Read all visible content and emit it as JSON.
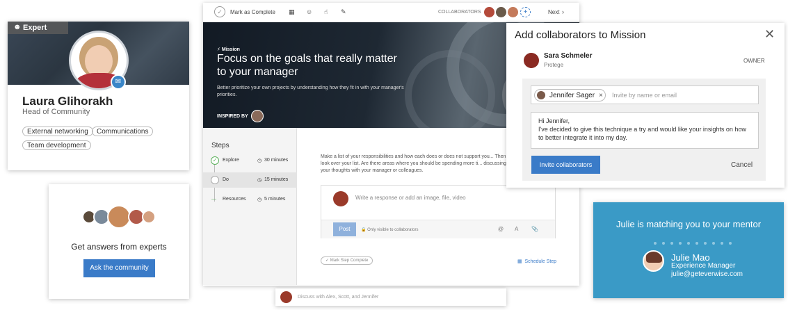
{
  "profile": {
    "badge": "Expert",
    "name": "Laura Glihorakh",
    "role": "Head of Community",
    "tags": [
      "External networking",
      "Communications",
      "Team development"
    ]
  },
  "ask": {
    "title": "Get answers from experts",
    "button": "Ask the community"
  },
  "app": {
    "topbar": {
      "mark_complete": "Mark as Complete",
      "collaborators_label": "COLLABORATORS",
      "next": "Next"
    },
    "hero": {
      "kicker": "Mission",
      "title": "Focus on the goals that really matter to your manager",
      "subtitle": "Better prioritize your own projects by understanding how they fit in with your manager's priorities.",
      "inspired_by": "INSPIRED BY"
    },
    "steps": {
      "heading": "Steps",
      "items": [
        {
          "label": "Explore",
          "duration": "30 minutes"
        },
        {
          "label": "Do",
          "duration": "15 minutes"
        },
        {
          "label": "Resources",
          "duration": "5 minutes"
        }
      ]
    },
    "body_text": "Make a list of your responsibilities and how each does or does not support you... Then look over your list. Are there areas where you should be spending more ti... discussing your thoughts with your manager or colleagues.",
    "composer": {
      "placeholder": "Write a response or add an image, file, video",
      "post": "Post",
      "visibility": "Only visible to collaborators"
    },
    "mark_step_complete": "Mark Step Complete",
    "schedule_step": "Schedule Step"
  },
  "discuss": {
    "placeholder": "Discuss with Alex, Scott, and Jennifer"
  },
  "collab": {
    "title": "Add collaborators to Mission",
    "owner": {
      "name": "Sara Schmeler",
      "role": "Protege",
      "tag": "OWNER"
    },
    "chip": "Jennifer Sager",
    "invite_placeholder": "Invite by name or email",
    "message": "Hi Jennifer,\nI've decided to give this technique a try and would like your insights on how to better integrate it into my day.",
    "invite_button": "Invite collaborators",
    "cancel": "Cancel"
  },
  "mentor": {
    "title": "Julie is matching you to your mentor",
    "name": "Julie Mao",
    "role": "Experience Manager",
    "email": "julie@geteverwise.com"
  },
  "colors": {
    "accent": "#3a7bc8",
    "mentor_bg": "#3a9ac6"
  }
}
